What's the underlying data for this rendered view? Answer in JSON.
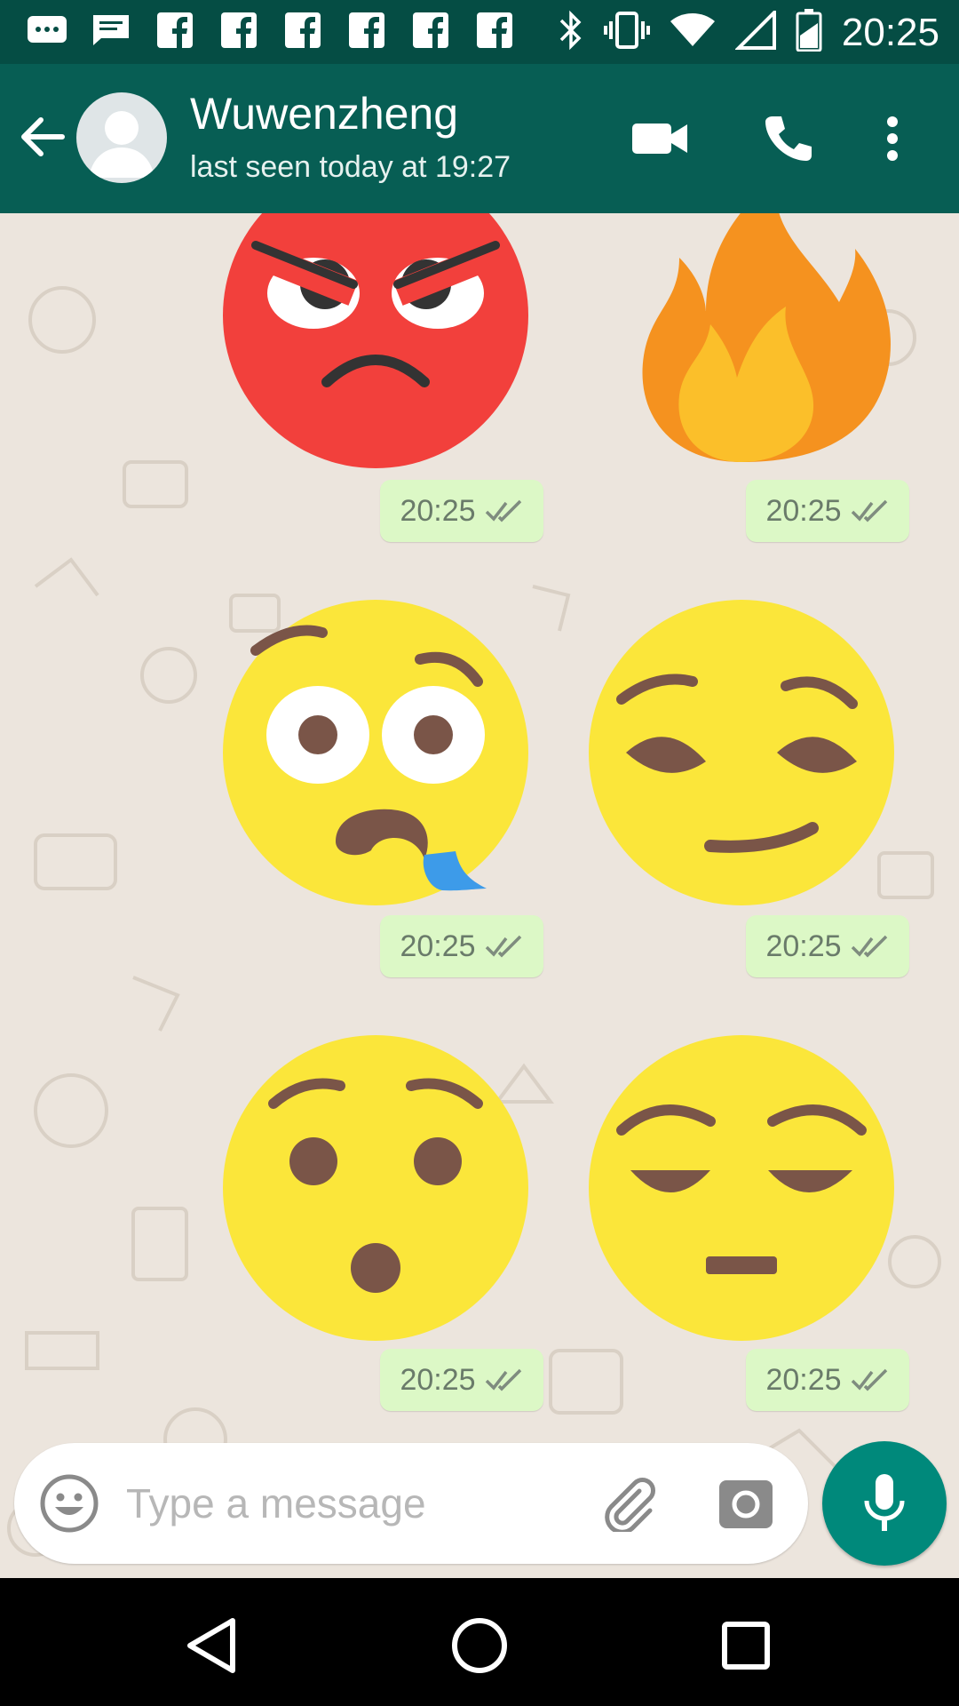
{
  "status_bar": {
    "time": "20:25",
    "left_icons": [
      "messages-icon",
      "chat-icon",
      "facebook-icon",
      "facebook-icon",
      "facebook-icon",
      "facebook-icon",
      "facebook-icon",
      "facebook-icon"
    ],
    "right_icons": [
      "bluetooth-icon",
      "vibrate-icon",
      "wifi-icon",
      "signal-icon",
      "battery-icon"
    ]
  },
  "header": {
    "contact_name": "Wuwenzheng",
    "last_seen": "last seen today at 19:27",
    "buttons": [
      "video-call-icon",
      "voice-call-icon",
      "more-menu-icon"
    ],
    "color": "#075e54"
  },
  "messages": [
    {
      "sticker": "angry-face",
      "time": "20:25",
      "status": "read"
    },
    {
      "sticker": "fire",
      "time": "20:25",
      "status": "read"
    },
    {
      "sticker": "drooling-face",
      "time": "20:25",
      "status": "read"
    },
    {
      "sticker": "smirking-face",
      "time": "20:25",
      "status": "read"
    },
    {
      "sticker": "hushed-face",
      "time": "20:25",
      "status": "read"
    },
    {
      "sticker": "relieved-face",
      "time": "20:25",
      "status": "read"
    }
  ],
  "composer": {
    "placeholder": "Type a message",
    "value": ""
  },
  "colors": {
    "accent": "#00897b",
    "bubble": "#dcf8c6",
    "chat_bg": "#ece5dd"
  }
}
